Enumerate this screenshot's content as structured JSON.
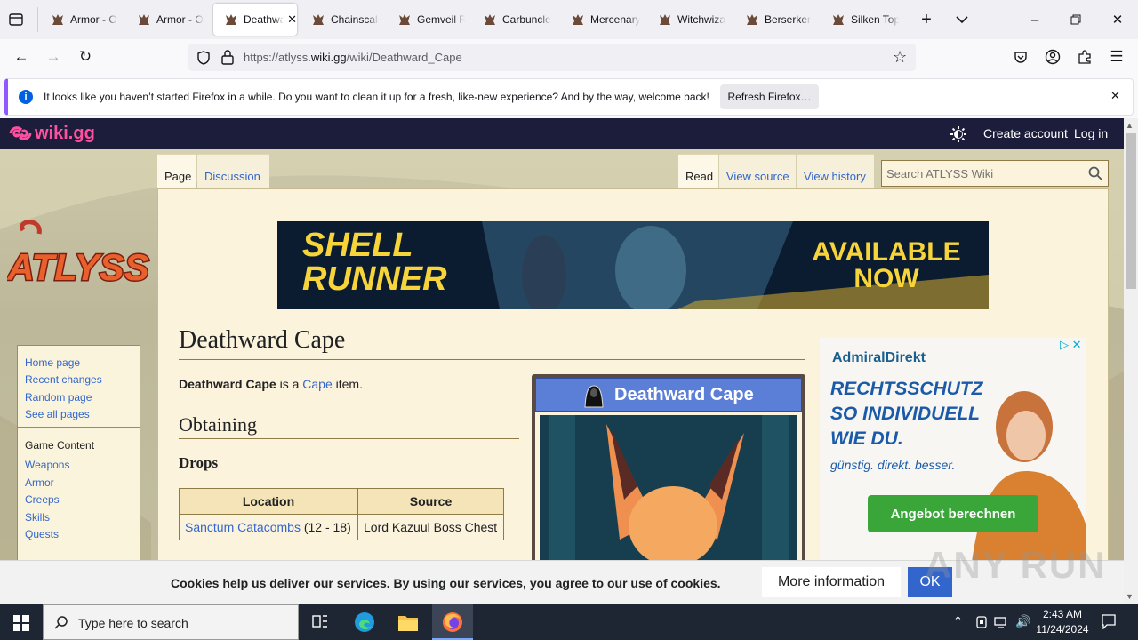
{
  "browser": {
    "tabs": [
      {
        "label": "Armor - O"
      },
      {
        "label": "Armor - O"
      },
      {
        "label": "Deathwa",
        "active": true
      },
      {
        "label": "Chainscale"
      },
      {
        "label": "Gemveil R"
      },
      {
        "label": "Carbuncle"
      },
      {
        "label": "Mercenary"
      },
      {
        "label": "Witchwiza"
      },
      {
        "label": "Berserker"
      },
      {
        "label": "Silken Top"
      }
    ],
    "url_prefix": "https://atlyss.",
    "url_domain": "wiki.gg",
    "url_path": "/wiki/Deathward_Cape",
    "notification": {
      "text": "It looks like you haven’t started Firefox in a while. Do you want to clean it up for a fresh, like-new experience? And by the way, welcome back!",
      "button": "Refresh Firefox…"
    }
  },
  "wiki": {
    "brand": "wiki.gg",
    "create_account": "Create account",
    "log_in": "Log in",
    "tabs_left": [
      "Page",
      "Discussion"
    ],
    "tabs_right": [
      "Read",
      "View source",
      "View history"
    ],
    "search_placeholder": "Search ATLYSS Wiki",
    "logo_text": "ATLYSS",
    "sidebar": {
      "nav": [
        "Home page",
        "Recent changes",
        "Random page",
        "See all pages"
      ],
      "section_title": "Game Content",
      "game": [
        "Weapons",
        "Armor",
        "Creeps",
        "Skills",
        "Quests"
      ]
    },
    "banner": {
      "left": "SHELL\nRUNNER",
      "right": "AVAILABLE\nNOW"
    },
    "page_title": "Deathward Cape",
    "intro_bold": "Deathward Cape",
    "intro_mid": " is a ",
    "intro_link": "Cape",
    "intro_end": " item.",
    "section_obtaining": "Obtaining",
    "section_drops": "Drops",
    "table": {
      "headers": [
        "Location",
        "Source"
      ],
      "rows": [
        {
          "location_link": "Sanctum Catacombs",
          "location_extra": " (12 - 18)",
          "source": "Lord Kazuul Boss Chest"
        }
      ]
    },
    "infobox_title": "Deathward Cape",
    "ad": {
      "brand": "AdmiralDirekt",
      "headline_1": "RECHTSSCHUTZ",
      "headline_2": "SO INDIVIDUELL",
      "headline_3": "WIE DU.",
      "tagline": "günstig. direkt. besser.",
      "cta": "Angebot berechnen"
    },
    "cookie": {
      "text": "Cookies help us deliver our services. By using our services, you agree to our use of cookies.",
      "more": "More information",
      "ok": "OK"
    }
  },
  "watermark": "ANY RUN",
  "taskbar": {
    "search_placeholder": "Type here to search",
    "time": "2:43 AM",
    "date": "11/24/2024"
  },
  "colors": {
    "wiki_bar": "#1c1d3a",
    "wiki_brand": "#ff4fa0",
    "link": "#3366cc",
    "infobox_header": "#5b7fd6",
    "ad_cta": "#3aa63a"
  }
}
